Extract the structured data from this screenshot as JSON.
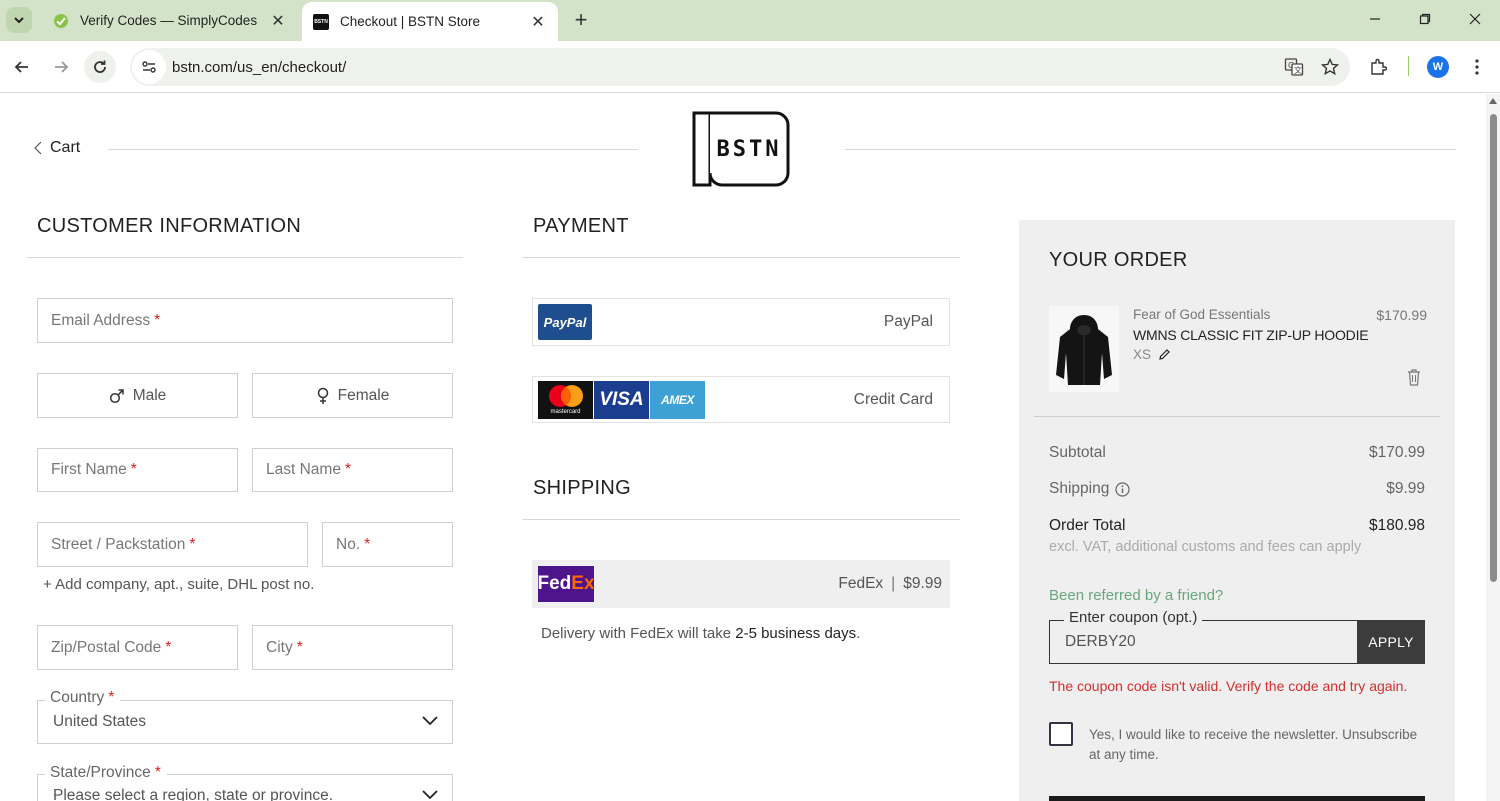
{
  "browser": {
    "tabs": [
      {
        "title": "Verify Codes — SimplyCodes",
        "active": false
      },
      {
        "title": "Checkout | BSTN Store",
        "active": true
      }
    ],
    "url": "bstn.com/us_en/checkout/",
    "profile_initial": "W",
    "bstn_favicon_text": "BSTN"
  },
  "header": {
    "back_label": "Cart",
    "logo_text": "BSTN"
  },
  "customer": {
    "title": "CUSTOMER INFORMATION",
    "email_label": "Email Address",
    "req": "*",
    "gender_male": "Male",
    "gender_female": "Female",
    "first_name_label": "First Name",
    "last_name_label": "Last Name",
    "street_label": "Street / Packstation",
    "number_label": "No.",
    "add_company_link": "+ Add company, apt., suite, DHL post no.",
    "zip_label": "Zip/Postal Code",
    "city_label": "City",
    "country_label": "Country",
    "country_value": "United States",
    "state_label": "State/Province",
    "state_placeholder": "Please select a region, state or province."
  },
  "payment": {
    "title": "PAYMENT",
    "paypal_badge": "PayPal",
    "paypal_label": "PayPal",
    "credit_card_label": "Credit Card",
    "visa_badge": "VISA",
    "amex_badge": "AMEX",
    "mastercard_badge": "mastercard"
  },
  "shipping": {
    "title": "SHIPPING",
    "carrier": "FedEx",
    "price": "$9.99",
    "fedex_badge_fd": "Fed",
    "fedex_badge_ex": "Ex",
    "note_prefix": "Delivery with FedEx will take ",
    "note_days": "2-5 business days",
    "note_suffix": "."
  },
  "order": {
    "title": "YOUR ORDER",
    "item": {
      "brand": "Fear of God Essentials",
      "name": "WMNS CLASSIC FIT ZIP-UP HOODIE",
      "size": "XS",
      "price": "$170.99"
    },
    "subtotal_label": "Subtotal",
    "subtotal_value": "$170.99",
    "shipping_label": "Shipping",
    "shipping_value": "$9.99",
    "total_label": "Order Total",
    "total_value": "$180.98",
    "vat_note": "excl. VAT, additional customs and fees can apply",
    "referral": "Been referred by a friend?",
    "coupon_label": "Enter coupon (opt.)",
    "coupon_value": "DERBY20",
    "apply_label": "APPLY",
    "coupon_error": "The coupon code isn't valid. Verify the code and try again.",
    "newsletter": "Yes, I would like to receive the newsletter. Unsubscribe at any time."
  },
  "colors": {
    "tabbar": "#d3e3c9",
    "error": "#d32f2f",
    "referral": "#6aa57c",
    "order_panel": "#efefef"
  }
}
